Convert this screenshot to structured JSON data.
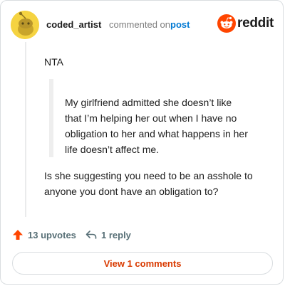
{
  "header": {
    "username": "coded_artist",
    "action_text": "commented on",
    "post_link": "post",
    "logo_text": "reddit"
  },
  "comment": {
    "body": "NTA",
    "quote_lines": [
      "My girlfriend admitted she doesn’t like",
      "that I’m helping her out when I have no",
      "obligation to her and what happens in her",
      "life doesn’t affect me."
    ],
    "reply_lines": [
      "Is she suggesting you need to be an asshole to",
      "anyone you dont have an obligation to?"
    ]
  },
  "actions": {
    "upvotes": "13 upvotes",
    "replies": "1 reply"
  },
  "footer": {
    "view_comments": "View 1 comments"
  },
  "colors": {
    "accent": "#ff4500",
    "link": "#0079d3",
    "view_comments": "#d93a00",
    "muted": "#576f76",
    "avatar": "#f5d341"
  },
  "icons": {
    "avatar": "snoo-avatar-icon",
    "logo": "reddit-snoo-icon",
    "upvote": "upvote-arrow-icon",
    "reply": "reply-arrow-icon"
  }
}
